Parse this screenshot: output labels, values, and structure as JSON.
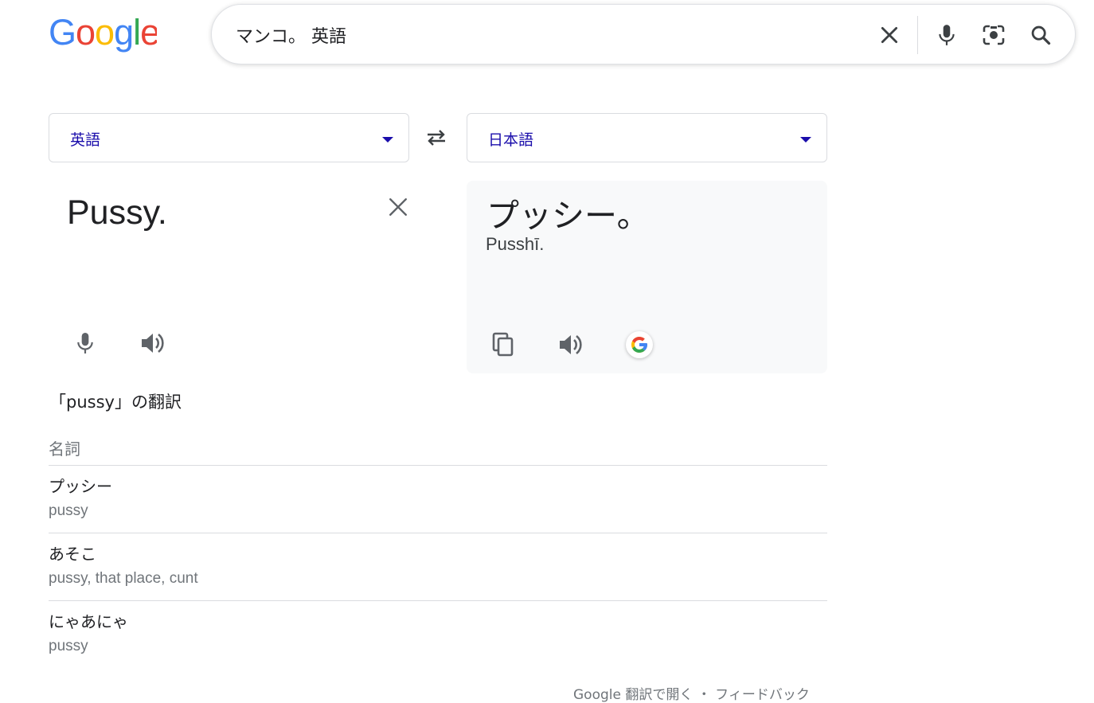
{
  "search": {
    "query": "マンコ。 英語"
  },
  "icons": {
    "clear": "close-icon",
    "voice": "microphone-icon",
    "lens": "camera-lens-icon",
    "search": "search-icon",
    "swap": "swap-arrows-icon",
    "copy": "copy-icon",
    "listen": "speaker-icon"
  },
  "colors": {
    "google_blue": "#4285F4",
    "google_red": "#EA4335",
    "google_yellow": "#FBBC05",
    "google_green": "#34A853",
    "link": "#1a0dab"
  },
  "translator": {
    "source_language": "英語",
    "target_language": "日本語",
    "source_text": "Pussy.",
    "target_text": "プッシー。",
    "target_transliteration": "Pusshī."
  },
  "dictionary": {
    "heading": "「pussy」の翻訳",
    "part_of_speech": "名詞",
    "entries": [
      {
        "word": "プッシー",
        "back": "pussy"
      },
      {
        "word": "あそこ",
        "back": "pussy, that place, cunt"
      },
      {
        "word": "にゃあにゃ",
        "back": "pussy"
      }
    ]
  },
  "footer": {
    "link_text": "Google 翻訳で開く ・ フィードバック"
  }
}
